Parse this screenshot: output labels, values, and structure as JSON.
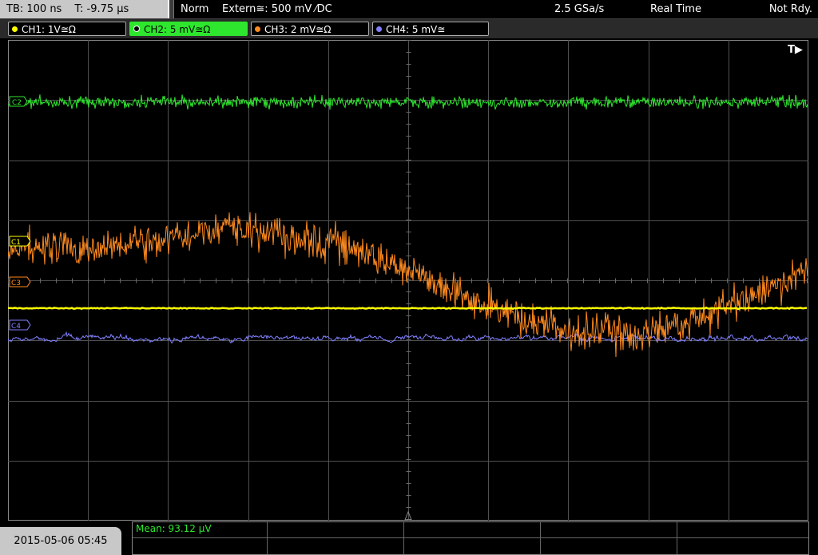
{
  "header": {
    "timebase": "TB: 100 ns",
    "trigger_pos": "T: -9.75 µs",
    "trigger_mode": "Norm",
    "trigger_source": "Extern≅: 500 mV ⁄DC",
    "sample_rate": "2.5 GSa/s",
    "acq_mode": "Real Time",
    "status": "Not Rdy."
  },
  "channels": [
    {
      "label": "CH1: 1V≅Ω",
      "color": "#ffff00",
      "active": false
    },
    {
      "label": "CH2: 5 mV≅Ω",
      "color": "#2ee62e",
      "active": true
    },
    {
      "label": "CH3: 2 mV≅Ω",
      "color": "#ff8a1e",
      "active": false
    },
    {
      "label": "CH4: 5 mV≅",
      "color": "#8080ff",
      "active": false
    }
  ],
  "markers": {
    "c2": "C2",
    "c1": "C1",
    "c3": "C3",
    "c4": "C4",
    "trigger": "T▶"
  },
  "footer": {
    "date": "2015-05-06 05:45",
    "mean": "Mean: 93.12 µV"
  },
  "colors": {
    "grid": "#505050",
    "ch1": "#ffff00",
    "ch2": "#2ee62e",
    "ch3": "#ff8a1e",
    "ch4": "#8080ff"
  }
}
